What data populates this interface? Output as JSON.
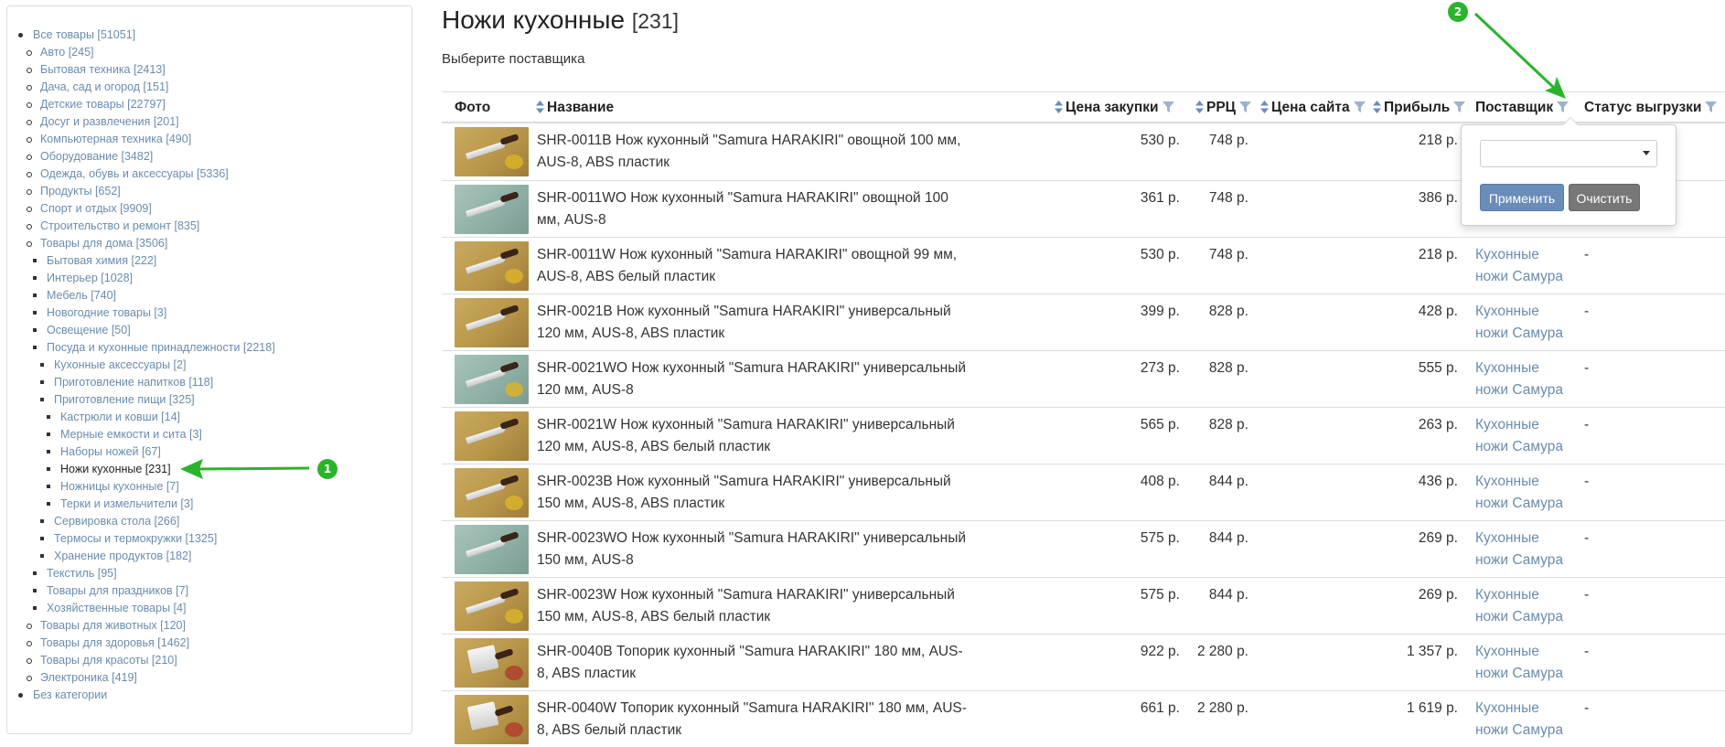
{
  "sidebar": {
    "tree": [
      {
        "label": "Все товары [51051]",
        "level": 0
      },
      {
        "label": "Авто [245]",
        "level": 1
      },
      {
        "label": "Бытовая техника [2413]",
        "level": 1
      },
      {
        "label": "Дача, сад и огород [151]",
        "level": 1
      },
      {
        "label": "Детские товары [22797]",
        "level": 1
      },
      {
        "label": "Досуг и развлечения [201]",
        "level": 1
      },
      {
        "label": "Компьютерная техника [490]",
        "level": 1
      },
      {
        "label": "Оборудование [3482]",
        "level": 1
      },
      {
        "label": "Одежда, обувь и аксессуары [5336]",
        "level": 1
      },
      {
        "label": "Продукты [652]",
        "level": 1
      },
      {
        "label": "Спорт и отдых [9909]",
        "level": 1
      },
      {
        "label": "Строительство и ремонт [835]",
        "level": 1
      },
      {
        "label": "Товары для дома [3506]",
        "level": 1
      },
      {
        "label": "Бытовая химия [222]",
        "level": 2
      },
      {
        "label": "Интерьер [1028]",
        "level": 2
      },
      {
        "label": "Мебель [740]",
        "level": 2
      },
      {
        "label": "Новогодние товары [3]",
        "level": 2
      },
      {
        "label": "Освещение [50]",
        "level": 2
      },
      {
        "label": "Посуда и кухонные принадлежности [2218]",
        "level": 2
      },
      {
        "label": "Кухонные аксессуары [2]",
        "level": 3
      },
      {
        "label": "Приготовление напитков [118]",
        "level": 3
      },
      {
        "label": "Приготовление пищи [325]",
        "level": 3
      },
      {
        "label": "Кастрюли и ковши [14]",
        "level": 4
      },
      {
        "label": "Мерные емкости и сита [3]",
        "level": 4
      },
      {
        "label": "Наборы ножей [67]",
        "level": 4
      },
      {
        "label": "Ножи кухонные [231]",
        "level": 4,
        "current": true
      },
      {
        "label": "Ножницы кухонные [7]",
        "level": 4
      },
      {
        "label": "Терки и измельчители [3]",
        "level": 4
      },
      {
        "label": "Сервировка стола [266]",
        "level": 3
      },
      {
        "label": "Термосы и термокружки [1325]",
        "level": 3
      },
      {
        "label": "Хранение продуктов [182]",
        "level": 3
      },
      {
        "label": "Текстиль [95]",
        "level": 2
      },
      {
        "label": "Товары для праздников [7]",
        "level": 2
      },
      {
        "label": "Хозяйственные товары [4]",
        "level": 2
      },
      {
        "label": "Товары для животных [120]",
        "level": 1
      },
      {
        "label": "Товары для здоровья [1462]",
        "level": 1
      },
      {
        "label": "Товары для красоты [210]",
        "level": 1
      },
      {
        "label": "Электроника [419]",
        "level": 1
      },
      {
        "label": "Без категории",
        "level": 0
      }
    ]
  },
  "page": {
    "title": "Ножи кухонные",
    "count": "[231]",
    "subtitle": "Выберите поставщика"
  },
  "table": {
    "columns": {
      "photo": "Фото",
      "name": "Название",
      "purchase_price": "Цена закупки",
      "rrp": "РРЦ",
      "site_price": "Цена сайта",
      "profit": "Прибыль",
      "supplier": "Поставщик",
      "export_status": "Статус выгрузки"
    },
    "rows": [
      {
        "name": "SHR-0011B Нож кухонный \"Samura HARAKIRI\" овощной 100 мм, AUS-8, ABS пластик",
        "purchase": "530 р.",
        "rrp": "748 р.",
        "profit": "218 р.",
        "supplier": "",
        "status": "",
        "thumb": "olive"
      },
      {
        "name": "SHR-0011WO Нож кухонный \"Samura HARAKIRI\" овощной 100 мм, AUS-8",
        "purchase": "361 р.",
        "rrp": "748 р.",
        "profit": "386 р.",
        "supplier": "",
        "status": "",
        "thumb": "teal"
      },
      {
        "name": "SHR-0011W Нож кухонный \"Samura HARAKIRI\" овощной 99 мм, AUS-8, ABS белый пластик",
        "purchase": "530 р.",
        "rrp": "748 р.",
        "profit": "218 р.",
        "supplier": "Кухонные ножи Самура",
        "status": "-",
        "thumb": "olive"
      },
      {
        "name": "SHR-0021B Нож кухонный \"Samura HARAKIRI\" универсальный 120 мм, AUS-8, ABS пластик",
        "purchase": "399 р.",
        "rrp": "828 р.",
        "profit": "428 р.",
        "supplier": "Кухонные ножи Самура",
        "status": "-",
        "thumb": "olive"
      },
      {
        "name": "SHR-0021WO Нож кухонный \"Samura HARAKIRI\" универсальный 120 мм, AUS-8",
        "purchase": "273 р.",
        "rrp": "828 р.",
        "profit": "555 р.",
        "supplier": "Кухонные ножи Самура",
        "status": "-",
        "thumb": "teal"
      },
      {
        "name": "SHR-0021W Нож кухонный \"Samura HARAKIRI\" универсальный 120 мм, AUS-8, ABS белый пластик",
        "purchase": "565 р.",
        "rrp": "828 р.",
        "profit": "263 р.",
        "supplier": "Кухонные ножи Самура",
        "status": "-",
        "thumb": "olive"
      },
      {
        "name": "SHR-0023B Нож кухонный \"Samura HARAKIRI\" универсальный 150 мм, AUS-8, ABS пластик",
        "purchase": "408 р.",
        "rrp": "844 р.",
        "profit": "436 р.",
        "supplier": "Кухонные ножи Самура",
        "status": "-",
        "thumb": "olive"
      },
      {
        "name": "SHR-0023WO Нож кухонный \"Samura HARAKIRI\" универсальный 150 мм, AUS-8",
        "purchase": "575 р.",
        "rrp": "844 р.",
        "profit": "269 р.",
        "supplier": "Кухонные ножи Самура",
        "status": "-",
        "thumb": "teal"
      },
      {
        "name": "SHR-0023W Нож кухонный \"Samura HARAKIRI\" универсальный 150 мм, AUS-8, ABS белый пластик",
        "purchase": "575 р.",
        "rrp": "844 р.",
        "profit": "269 р.",
        "supplier": "Кухонные ножи Самура",
        "status": "-",
        "thumb": "olive"
      },
      {
        "name": "SHR-0040B Топорик кухонный \"Samura HARAKIRI\" 180 мм, AUS-8, ABS пластик",
        "purchase": "922 р.",
        "rrp": "2 280 р.",
        "profit": "1 357 р.",
        "supplier": "Кухонные ножи Самура",
        "status": "-",
        "thumb": "olive",
        "cleaver": true
      },
      {
        "name": "SHR-0040W Топорик кухонный \"Samura HARAKIRI\" 180 мм, AUS-8, ABS белый пластик",
        "purchase": "661 р.",
        "rrp": "2 280 р.",
        "profit": "1 619 р.",
        "supplier": "Кухонные ножи Самура",
        "status": "-",
        "thumb": "olive",
        "cleaver": true
      }
    ]
  },
  "filter_popover": {
    "select_value": "",
    "apply_label": "Применить",
    "clear_label": "Очистить"
  },
  "annotations": {
    "badge1": "1",
    "badge2": "2",
    "color": "#2bb32b"
  }
}
